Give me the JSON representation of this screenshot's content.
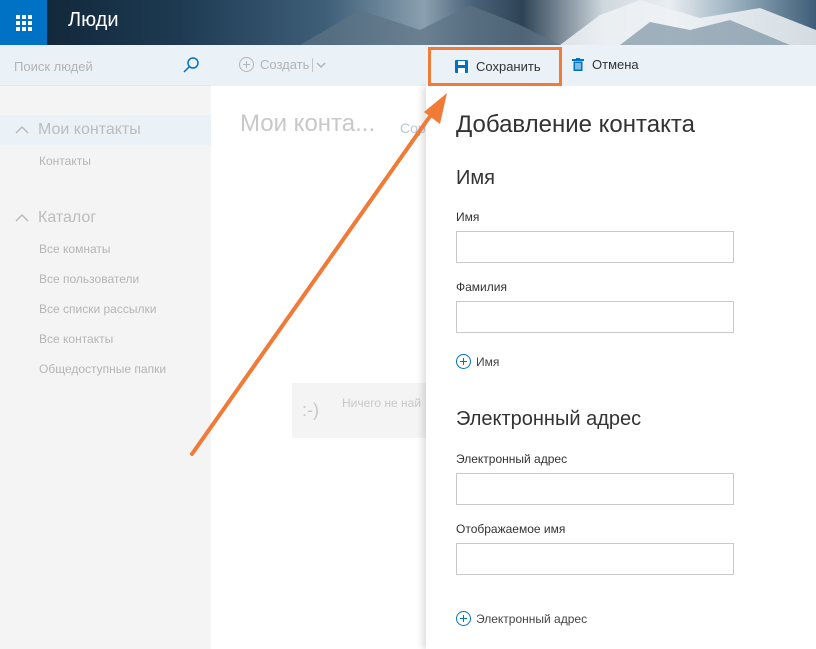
{
  "header": {
    "app_title": "Люди"
  },
  "sidebar": {
    "search_placeholder": "Поиск людей",
    "groups": [
      {
        "label": "Мои контакты",
        "items": [
          "Контакты"
        ]
      },
      {
        "label": "Каталог",
        "items": [
          "Все комнаты",
          "Все пользователи",
          "Все списки рассылки",
          "Все контакты",
          "Общедоступные папки"
        ]
      }
    ]
  },
  "toolbar": {
    "create_label": "Создать",
    "save_label": "Сохранить",
    "cancel_label": "Отмена"
  },
  "middle": {
    "title": "Мои конта...",
    "link": "Сор",
    "empty_face": ":-)",
    "empty_text": "Ничего не най"
  },
  "form": {
    "title": "Добавление контакта",
    "name_section": "Имя",
    "first_name_label": "Имя",
    "last_name_label": "Фамилия",
    "add_name_label": "Имя",
    "email_section": "Электронный адрес",
    "email_label": "Электронный адрес",
    "display_name_label": "Отображаемое имя",
    "add_email_label": "Электронный адрес"
  },
  "colors": {
    "accent": "#0072c6",
    "highlight": "#f07a36"
  }
}
